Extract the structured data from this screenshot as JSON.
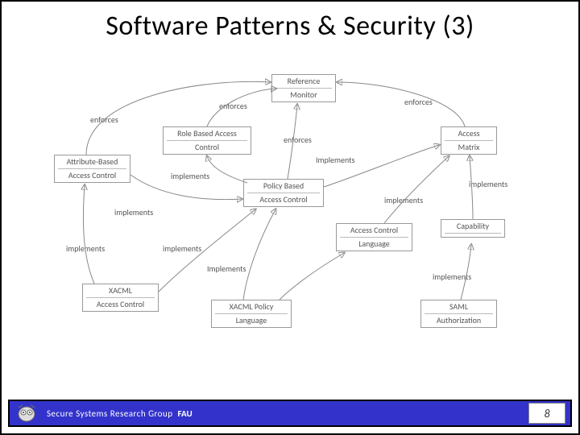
{
  "title": "Software Patterns & Security (3)",
  "footer": {
    "group_label": "Secure Systems Research Group",
    "org_label": "FAU",
    "page_number": "8"
  },
  "nodes": {
    "reference_monitor": {
      "line1": "Reference",
      "line2": "Monitor"
    },
    "rbac": {
      "line1": "Role Based  Access",
      "line2": "Control"
    },
    "abac": {
      "line1": "Attribute-Based",
      "line2": "Access Control"
    },
    "access_matrix": {
      "line1": "Access",
      "line2": "Matrix"
    },
    "pbac": {
      "line1": "Policy Based",
      "line2": "Access Control"
    },
    "acl": {
      "line1": "Access Control",
      "line2": "Language"
    },
    "capability": {
      "line1": "Capability",
      "line2": ""
    },
    "xacml_ac": {
      "line1": "XACML",
      "line2": "Access Control"
    },
    "xacml_policy": {
      "line1": "XACML Policy",
      "line2": "Language"
    },
    "saml": {
      "line1": "SAML",
      "line2": "Authorization"
    }
  },
  "edge_labels": {
    "e1": "enforces",
    "e2": "enforces",
    "e3": "enforces",
    "e4": "enforces",
    "e5": "implements",
    "e6": "Implements",
    "e7": "implements",
    "e8": "implements",
    "e9": "implements",
    "e10": "implements",
    "e11": "Implements",
    "e12": "implements"
  }
}
